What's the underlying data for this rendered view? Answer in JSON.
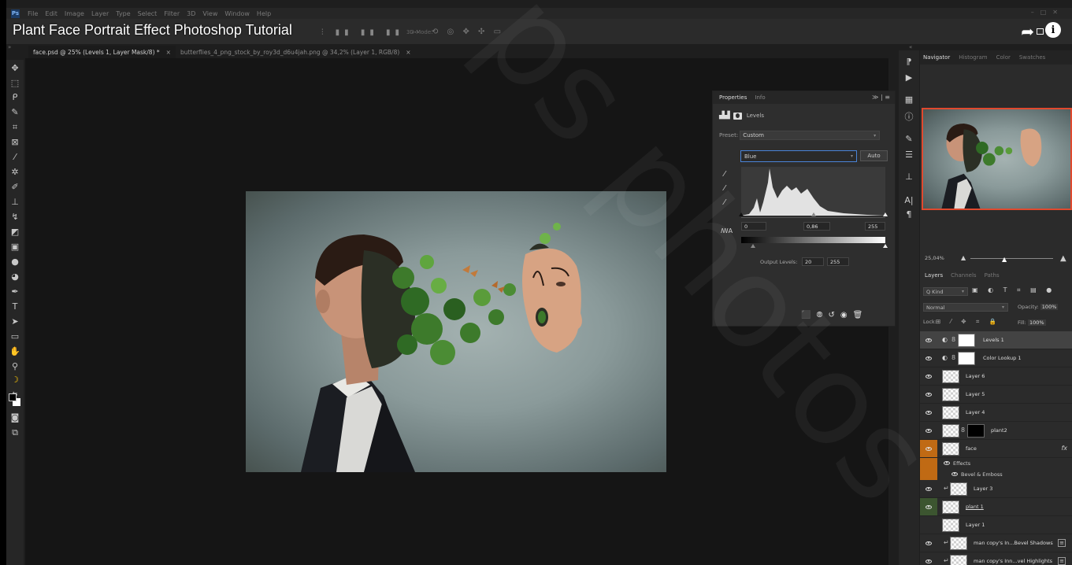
{
  "video_title": "Plant Face Portrait Effect Photoshop Tutorial",
  "menu": [
    "File",
    "Edit",
    "Image",
    "Layer",
    "Type",
    "Select",
    "Filter",
    "3D",
    "View",
    "Window",
    "Help"
  ],
  "options_bar": {
    "mode_3d_label": "3D Mode:"
  },
  "tabs": [
    {
      "title": "face.psd @ 25% (Levels 1, Layer Mask/8) *",
      "close": "×"
    },
    {
      "title": "butterflies_4_png_stock_by_roy3d_d6u4jah.png @ 34,2% (Layer 1, RGB/8)",
      "close": "×"
    }
  ],
  "properties": {
    "tabs": [
      "Properties",
      "Info"
    ],
    "menu_glyph": "≫ | ≡",
    "title": "Levels",
    "preset_label": "Preset:",
    "preset_value": "Custom",
    "channel": "Blue",
    "auto_label": "Auto",
    "input_black": "0",
    "input_gamma": "0,86",
    "input_white": "255",
    "output_label": "Output Levels:",
    "output_black": "20",
    "output_white": "255",
    "input_slider_fractions": [
      0.0,
      0.5,
      1.0
    ],
    "output_slider_fractions": [
      0.08,
      1.0
    ]
  },
  "navigator": {
    "tabs": [
      "Navigator",
      "Histogram",
      "Color",
      "Swatches"
    ],
    "zoom": "25,04%"
  },
  "layers_panel": {
    "tabs": [
      "Layers",
      "Channels",
      "Paths"
    ],
    "kind_label": "Q Kind",
    "blend_mode": "Normal",
    "opacity_label": "Opacity:",
    "opacity_value": "100%",
    "lock_label": "Lock:",
    "fill_label": "Fill:",
    "fill_value": "100%",
    "layers": [
      {
        "name": "Levels 1"
      },
      {
        "name": "Color Lookup 1"
      },
      {
        "name": "Layer 6"
      },
      {
        "name": "Layer 5"
      },
      {
        "name": "Layer 4"
      },
      {
        "name": "plant2"
      },
      {
        "name": "face",
        "fx": "fx",
        "effects_label": "Effects",
        "effect": "Bevel & Emboss"
      },
      {
        "name": "Layer 3"
      },
      {
        "name": "plant 1"
      },
      {
        "name": "Layer 1"
      },
      {
        "name": "man copy's In...Bevel Shadows"
      },
      {
        "name": "man copy's Inn...vel Highlights"
      }
    ]
  },
  "watermark": "ps photos"
}
